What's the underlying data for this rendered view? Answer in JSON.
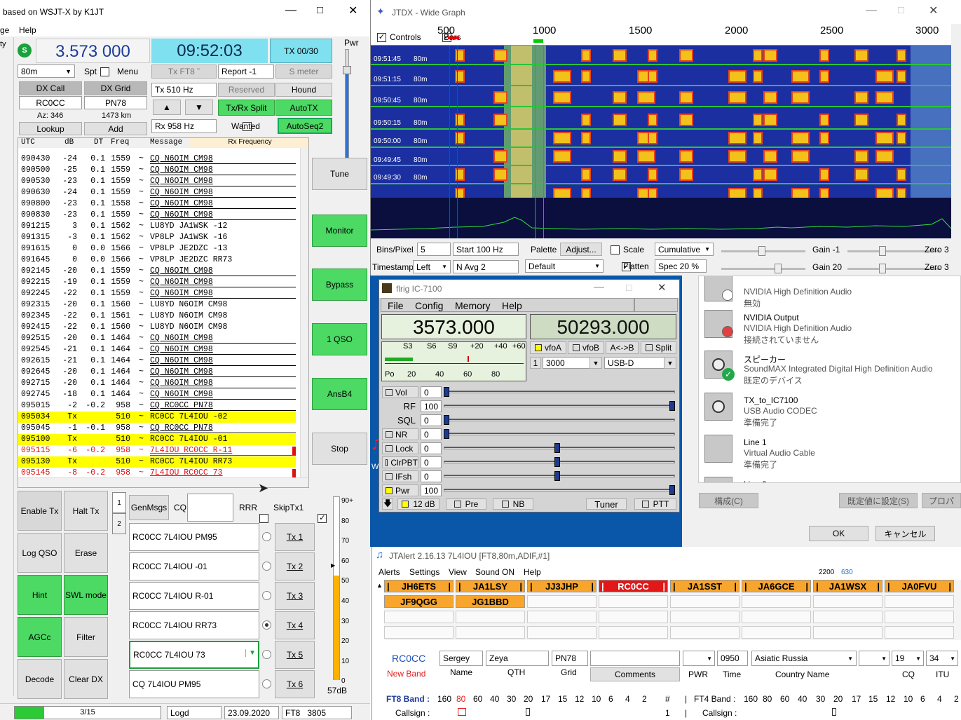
{
  "wsjt": {
    "title": "based on WSJT-X by K1JT",
    "menu": [
      "ge",
      "Help"
    ],
    "menu_left": "ty",
    "freq": "3.573 000",
    "time": "09:52:03",
    "tx_count": "TX 00/30",
    "band": "80m",
    "spt": "Spt",
    "menu_label": "Menu",
    "tx_mode": "Tx FT8 ˜",
    "report": "Report -1",
    "smeter": "S meter",
    "dx_call_label": "DX Call",
    "dx_grid_label": "DX Grid",
    "dx_call": "RC0CC",
    "dx_grid": "PN78",
    "az": "Az: 346",
    "dist": "1473 km",
    "lookup": "Lookup",
    "add": "Add",
    "tx_hz": "Tx  510  Hz",
    "rx_hz": "Rx  958  Hz",
    "reserved": "Reserved",
    "hound": "Hound",
    "txrx_split": "Tx/Rx Split",
    "autotx": "AutoTX",
    "wanted": "Wanted",
    "autoseq": "AutoSeq2",
    "pwr": "Pwr",
    "col_headers": [
      "UTC",
      "dB",
      "DT",
      "Freq",
      "Message"
    ],
    "rx_frequency": "Rx Frequency",
    "messages": [
      {
        "t": "090430",
        "db": "-24",
        "dt": "0.1",
        "f": "1559",
        "m": "CQ N6OIM CM98",
        "k": "cq"
      },
      {
        "t": "090500",
        "db": "-25",
        "dt": "0.1",
        "f": "1559",
        "m": "CQ N6OIM CM98",
        "k": "cq"
      },
      {
        "t": "090530",
        "db": "-23",
        "dt": "0.1",
        "f": "1559",
        "m": "CQ N6OIM CM98",
        "k": "cq"
      },
      {
        "t": "090630",
        "db": "-24",
        "dt": "0.1",
        "f": "1559",
        "m": "CQ N6OIM CM98",
        "k": "cq"
      },
      {
        "t": "090800",
        "db": "-23",
        "dt": "0.1",
        "f": "1558",
        "m": "CQ N6OIM CM98",
        "k": "cq"
      },
      {
        "t": "090830",
        "db": "-23",
        "dt": "0.1",
        "f": "1559",
        "m": "CQ N6OIM CM98",
        "k": "cq"
      },
      {
        "t": "091215",
        "db": "3",
        "dt": "0.1",
        "f": "1562",
        "m": "LU8YD JA1WSK -12",
        "k": ""
      },
      {
        "t": "091315",
        "db": "-3",
        "dt": "0.1",
        "f": "1562",
        "m": "VP8LP JA1WSK -16",
        "k": ""
      },
      {
        "t": "091615",
        "db": "0",
        "dt": "0.0",
        "f": "1566",
        "m": "VP8LP JE2DZC -13",
        "k": ""
      },
      {
        "t": "091645",
        "db": "0",
        "dt": "0.0",
        "f": "1566",
        "m": "VP8LP JE2DZC RR73",
        "k": ""
      },
      {
        "t": "092145",
        "db": "-20",
        "dt": "0.1",
        "f": "1559",
        "m": "CQ N6OIM CM98",
        "k": "cq"
      },
      {
        "t": "092215",
        "db": "-19",
        "dt": "0.1",
        "f": "1559",
        "m": "CQ N6OIM CM98",
        "k": "cq"
      },
      {
        "t": "092245",
        "db": "-22",
        "dt": "0.1",
        "f": "1559",
        "m": "CQ N6OIM CM98",
        "k": "cq"
      },
      {
        "t": "092315",
        "db": "-20",
        "dt": "0.1",
        "f": "1560",
        "m": "LU8YD N6OIM CM98",
        "k": ""
      },
      {
        "t": "092345",
        "db": "-22",
        "dt": "0.1",
        "f": "1561",
        "m": "LU8YD N6OIM CM98",
        "k": ""
      },
      {
        "t": "092415",
        "db": "-22",
        "dt": "0.1",
        "f": "1560",
        "m": "LU8YD N6OIM CM98",
        "k": ""
      },
      {
        "t": "092515",
        "db": "-20",
        "dt": "0.1",
        "f": "1464",
        "m": "CQ N6OIM CM98",
        "k": "cq"
      },
      {
        "t": "092545",
        "db": "-21",
        "dt": "0.1",
        "f": "1464",
        "m": "CQ N6OIM CM98",
        "k": "cq"
      },
      {
        "t": "092615",
        "db": "-21",
        "dt": "0.1",
        "f": "1464",
        "m": "CQ N6OIM CM98",
        "k": "cq"
      },
      {
        "t": "092645",
        "db": "-20",
        "dt": "0.1",
        "f": "1464",
        "m": "CQ N6OIM CM98",
        "k": "cq"
      },
      {
        "t": "092715",
        "db": "-20",
        "dt": "0.1",
        "f": "1464",
        "m": "CQ N6OIM CM98",
        "k": "cq"
      },
      {
        "t": "092745",
        "db": "-18",
        "dt": "0.1",
        "f": "1464",
        "m": "CQ N6OIM CM98",
        "k": "cq"
      },
      {
        "t": "095015",
        "db": "-2",
        "dt": "-0.2",
        "f": "958",
        "m": "CQ RC0CC PN78",
        "k": "cq"
      },
      {
        "t": "095034",
        "db": "Tx",
        "dt": "",
        "f": "510",
        "m": "RC0CC 7L4IOU -02",
        "k": "tx"
      },
      {
        "t": "095045",
        "db": "-1",
        "dt": "-0.1",
        "f": "958",
        "m": "CQ RC0CC PN78",
        "k": "cq"
      },
      {
        "t": "095100",
        "db": "Tx",
        "dt": "",
        "f": "510",
        "m": "RC0CC 7L4IOU -01",
        "k": "tx"
      },
      {
        "t": "095115",
        "db": "-6",
        "dt": "-0.2",
        "f": "958",
        "m": "7L4IOU RC0CC R-11",
        "k": "red"
      },
      {
        "t": "095130",
        "db": "Tx",
        "dt": "",
        "f": "510",
        "m": "RC0CC 7L4IOU RR73",
        "k": "tx"
      },
      {
        "t": "095145",
        "db": "-8",
        "dt": "-0.2",
        "f": "958",
        "m": "7L4IOU RC0CC 73",
        "k": "red"
      }
    ],
    "side_buttons": [
      "Tune",
      "Monitor",
      "Bypass",
      "1 QSO",
      "AnsB4",
      "Stop"
    ],
    "enable_tx": "Enable Tx",
    "halt_tx": "Halt Tx",
    "log_qso": "Log QSO",
    "erase": "Erase",
    "hint": "Hint",
    "swl_mode": "SWL mode",
    "agcc": "AGCc",
    "filter": "Filter",
    "decode": "Decode",
    "clear_dx": "Clear DX",
    "tab1": "1",
    "tab2": "2",
    "gen_msgs": "GenMsgs",
    "cq": "CQ",
    "rrr": "RRR",
    "skiptx1": "SkipTx1",
    "tx_messages": [
      "RC0CC 7L4IOU PM95",
      "RC0CC 7L4IOU -01",
      "RC0CC 7L4IOU R-01",
      "RC0CC 7L4IOU RR73",
      "RC0CC 7L4IOU 73",
      "CQ 7L4IOU PM95"
    ],
    "tx_buttons": [
      "Tx 1",
      "Tx 2",
      "Tx 3",
      "Tx 4",
      "Tx 5",
      "Tx 6"
    ],
    "meter_ticks": [
      "90+",
      "80",
      "70",
      "60",
      "50",
      "40",
      "30",
      "20",
      "10",
      "0"
    ],
    "meter_db": "57dB",
    "meter_level": 0.57,
    "status_progress": "3/15",
    "progress_fraction": 0.2,
    "status_logd": "Logd",
    "status_date": "23.09.2020",
    "status_mode": "FT8",
    "status_num": "3805"
  },
  "wide": {
    "title": "JTDX - Wide Graph",
    "controls": "Controls",
    "bars": "Bars",
    "scale_labels": [
      "500",
      "1000",
      "1500",
      "2000",
      "2500",
      "3000"
    ],
    "time_labels": [
      "09:51:45",
      "09:51:15",
      "09:50:45",
      "09:50:15",
      "09:50:00",
      "09:49:45",
      "09:49:30"
    ],
    "band_tag": "80m",
    "bins_label": "Bins/Pixel",
    "bins": "5",
    "start": "Start 100 Hz",
    "palette": "Palette",
    "adjust": "Adjust...",
    "scale": "Scale",
    "cumulative": "Cumulative",
    "gain1": "Gain -1",
    "zero1": "Zero 3",
    "timestamp": "Timestamp",
    "ts_val": "Left",
    "navg": "N Avg 2",
    "palette_val": "Default",
    "flatten": "Flatten",
    "spec": "Spec 20 %",
    "gain2": "Gain 20",
    "zero2": "Zero 3"
  },
  "flrig": {
    "title": "flrig IC-7100",
    "menu": [
      "File",
      "Config",
      "Memory",
      "Help"
    ],
    "freqA": "3573.000",
    "freqB": "50293.000",
    "s_scale": [
      "S3",
      "S6",
      "S9",
      "+20",
      "+40",
      "+60"
    ],
    "p_scale": [
      "Po",
      "20",
      "40",
      "60",
      "80"
    ],
    "vfoA": "vfoA",
    "vfoB": "vfoB",
    "atob": "A<->B",
    "split": "Split",
    "bw_idx": "1",
    "bw": "3000",
    "mode": "USB-D",
    "sliders": [
      {
        "name": "Vol",
        "val": "0",
        "pos": 0.0
      },
      {
        "name": "RF",
        "val": "100",
        "pos": 1.0
      },
      {
        "name": "SQL",
        "val": "0",
        "pos": 0.0
      },
      {
        "name": "NR",
        "val": "0",
        "pos": 0.0
      },
      {
        "name": "Lock",
        "val": "0",
        "pos": 0.49
      },
      {
        "name": "ClrPBT",
        "val": "0",
        "pos": 0.49
      },
      {
        "name": "IFsh",
        "val": "0",
        "pos": 0.49
      },
      {
        "name": "Pwr",
        "val": "100",
        "pos": 1.0
      }
    ],
    "atten": "12 dB",
    "pre": "Pre",
    "nb": "NB",
    "tuner": "Tuner",
    "ptt": "PTT"
  },
  "sound": {
    "devices": [
      {
        "name": "",
        "sub1": "NVIDIA High Definition Audio",
        "sub2": "無効",
        "icon": "monitor-disabled-icon"
      },
      {
        "name": "NVIDIA Output",
        "sub1": "NVIDIA High Definition Audio",
        "sub2": "接続されていません",
        "icon": "monitor-disconnected-icon"
      },
      {
        "name": "スピーカー",
        "sub1": "SoundMAX Integrated Digital High Definition Audio",
        "sub2": "既定のデバイス",
        "icon": "speaker-default-icon"
      },
      {
        "name": "TX_to_IC7100",
        "sub1": "USB Audio CODEC",
        "sub2": "準備完了",
        "icon": "speaker-icon"
      },
      {
        "name": "Line 1",
        "sub1": "Virtual Audio Cable",
        "sub2": "準備完了",
        "icon": "cable-icon"
      },
      {
        "name": "Line 2",
        "sub1": "",
        "sub2": "",
        "icon": "cable-icon"
      }
    ],
    "configure": "構成(C)",
    "set_default": "既定値に設定(S)",
    "properties": "プロパ",
    "ok": "OK",
    "cancel": "キャンセル"
  },
  "jtalert": {
    "title": "JTAlert 2.16.13 7L4IOU [FT8,80m,ADIF,#1]",
    "menu": [
      "Alerts",
      "Settings",
      "View",
      "Sound ON",
      "Help"
    ],
    "num1": "2200",
    "num2": "630",
    "row1": [
      "JH6ETS",
      "JA1LSY",
      "JJ3JHP",
      "RC0CC",
      "JA1SST",
      "JA6GCE",
      "JA1WSX",
      "JA0FVU"
    ],
    "row2": [
      "JF9QGG",
      "JG1BBD"
    ],
    "call": "RC0CC",
    "new_band": "New Band",
    "name": "Sergey",
    "qth": "Zeya",
    "grid": "PN78",
    "time": "0950",
    "country": "Asiatic Russia",
    "cq": "19",
    "itu": "34",
    "labels": [
      "Name",
      "QTH",
      "Grid",
      "Comments",
      "PWR",
      "Time",
      "Country Name",
      "CQ",
      "ITU"
    ],
    "ft8_band": "FT8 Band :",
    "bands": [
      "160",
      "80",
      "60",
      "40",
      "30",
      "20",
      "17",
      "15",
      "12",
      "10",
      "6",
      "4",
      "2"
    ],
    "hash": "#",
    "ft4_band": "FT4 Band :",
    "callsign": "Callsign :",
    "one": "1"
  }
}
